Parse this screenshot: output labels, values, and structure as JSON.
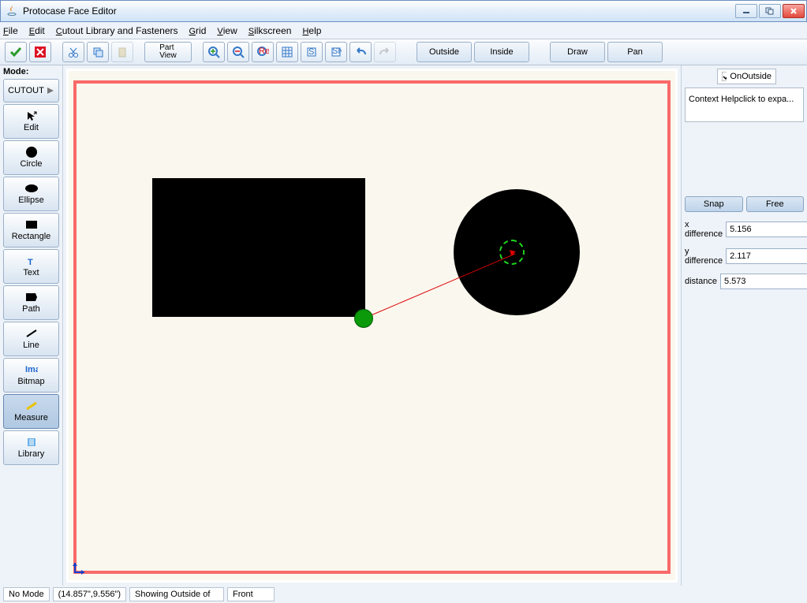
{
  "window": {
    "title": "Protocase Face Editor"
  },
  "menu": {
    "file": "File",
    "edit": "Edit",
    "cutlib": "Cutout Library and Fasteners",
    "grid": "Grid",
    "view": "View",
    "silk": "Silkscreen",
    "help": "Help"
  },
  "toolbar": {
    "partview": "Part\nView",
    "outside": "Outside",
    "inside": "Inside",
    "draw": "Draw",
    "pan": "Pan"
  },
  "modes": {
    "label": "Mode:",
    "cutout": "CUTOUT",
    "edit": "Edit",
    "circle": "Circle",
    "ellipse": "Ellipse",
    "rectangle": "Rectangle",
    "text": "Text",
    "path": "Path",
    "line": "Line",
    "bitmap": "Bitmap",
    "measure": "Measure",
    "library": "Library"
  },
  "right": {
    "onoutside": "OnOutside",
    "ctxhelp": "Context Helpclick to expa...",
    "snap": "Snap",
    "free": "Free",
    "xdiff_label": "x difference",
    "xdiff": "5.156",
    "ydiff_label": "y difference",
    "ydiff": "2.117",
    "dist_label": "distance",
    "dist": "5.573"
  },
  "status": {
    "mode": "No Mode",
    "coords": "(14.857\",9.556\")",
    "showing": "Showing Outside of",
    "face": "Front"
  }
}
